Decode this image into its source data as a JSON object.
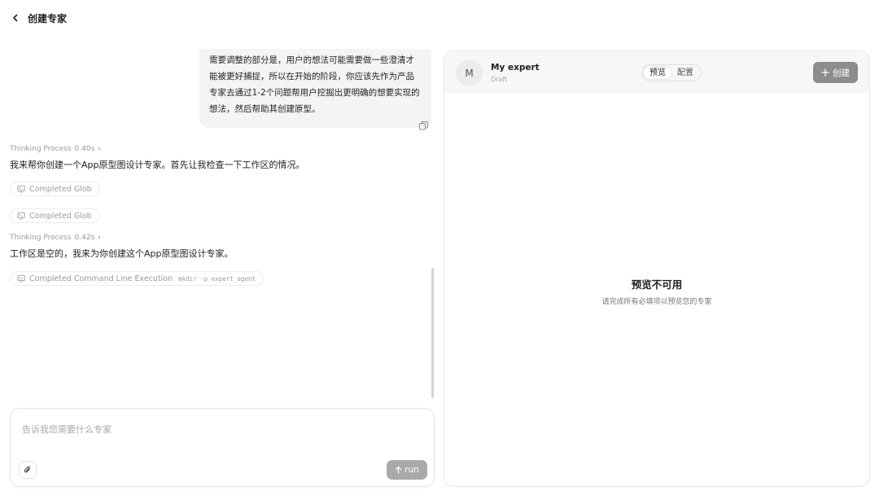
{
  "header": {
    "back_icon": "chevron-left-icon",
    "title": "创建专家"
  },
  "chat": {
    "user_message": "需要调整的部分是，用户的想法可能需要做一些澄清才能被更好捕捉，所以在开始的阶段，你应该先作为产品专家去通过1-2个问题帮用户挖掘出更明确的想要实现的想法，然后帮助其创建原型。",
    "copy_icon": "copy-icon",
    "thinking_1": {
      "label": "Thinking Process",
      "time": "0.40s",
      "chevron": "›"
    },
    "assistant_1": "我来帮你创建一个App原型图设计专家。首先让我检查一下工作区的情况。",
    "tool_1": {
      "icon": "terminal-icon",
      "label": "Completed Glob"
    },
    "tool_2": {
      "icon": "terminal-icon",
      "label": "Completed Glob"
    },
    "thinking_2": {
      "label": "Thinking Process",
      "time": "0.42s",
      "chevron": "›"
    },
    "assistant_2": "工作区是空的，我来为你创建这个App原型图设计专家。",
    "tool_3": {
      "icon": "terminal-icon",
      "label": "Completed Command Line Execution",
      "command": "mkdir -p expert_agent"
    }
  },
  "composer": {
    "placeholder": "告诉我您需要什么专家",
    "value": "",
    "attach_icon": "paperclip-icon",
    "run_label": "run",
    "run_icon": "arrow-up-icon"
  },
  "preview": {
    "avatar_letter": "M",
    "name": "My expert",
    "status": "Draft",
    "tabs": [
      "预览",
      "配置"
    ],
    "active_tab": "预览",
    "create_label": "创建",
    "create_icon": "plus-icon",
    "empty_title": "预览不可用",
    "empty_subtitle": "请完成所有必填项以预览您的专家"
  },
  "colors": {
    "run_button": "#a9a9a9",
    "create_button": "#8d8d8d",
    "bubble_bg": "#f4f4f5"
  }
}
